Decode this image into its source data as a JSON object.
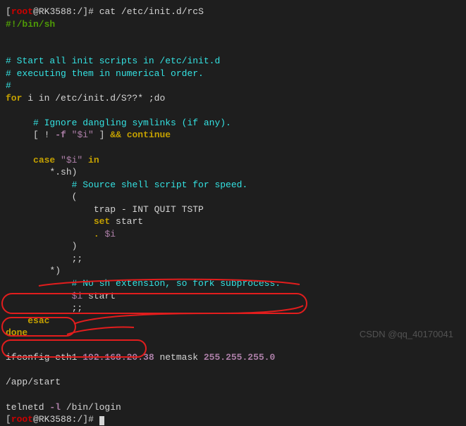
{
  "prompt_host": "RK3588",
  "prompt_path": "/",
  "prompt_user": "root",
  "cmd": "cat /etc/init.d/rcS",
  "shebang": "#!/bin/sh",
  "comment_block": {
    "l1": "# Start all init scripts in /etc/init.d",
    "l2": "# executing them in numerical order.",
    "l3": "#"
  },
  "for_kw": "for",
  "for_rest": " i in /etc/init.d/S??* ;do",
  "ignore_comment": "# Ignore dangling symlinks (if any).",
  "test_open": "[ ! ",
  "test_flag": "-f",
  "test_str": "\"$i\"",
  "test_close": " ] ",
  "andand": "&&",
  "continue_kw": " continue",
  "case_kw": "case ",
  "case_var": "\"$i\"",
  "case_in": " in",
  "pat_sh": "*.sh)",
  "source_comment": "# Source shell script for speed.",
  "paren_open": "(",
  "trap_line": "trap - INT QUIT TSTP",
  "set_kw": "set",
  "set_arg": " start",
  "dot": ". ",
  "dot_var": "$i",
  "paren_close": ")",
  "dsemi": ";;",
  "pat_star": "*)",
  "fork_comment": "# No sh extension, so fork subprocess.",
  "fork_var": "$i",
  "fork_arg": " start",
  "esac_kw": "esac",
  "done_kw": "done",
  "ifconfig": {
    "cmd": "ifconfig eth1 ",
    "ip": "192.168.20.38",
    "mid": " netmask ",
    "mask": "255.255.255.0"
  },
  "app_start": "/app/start",
  "telnetd": {
    "cmd": "telnetd ",
    "flag": "-l ",
    "path": "/bin/login"
  },
  "watermark": "CSDN @qq_40170041"
}
